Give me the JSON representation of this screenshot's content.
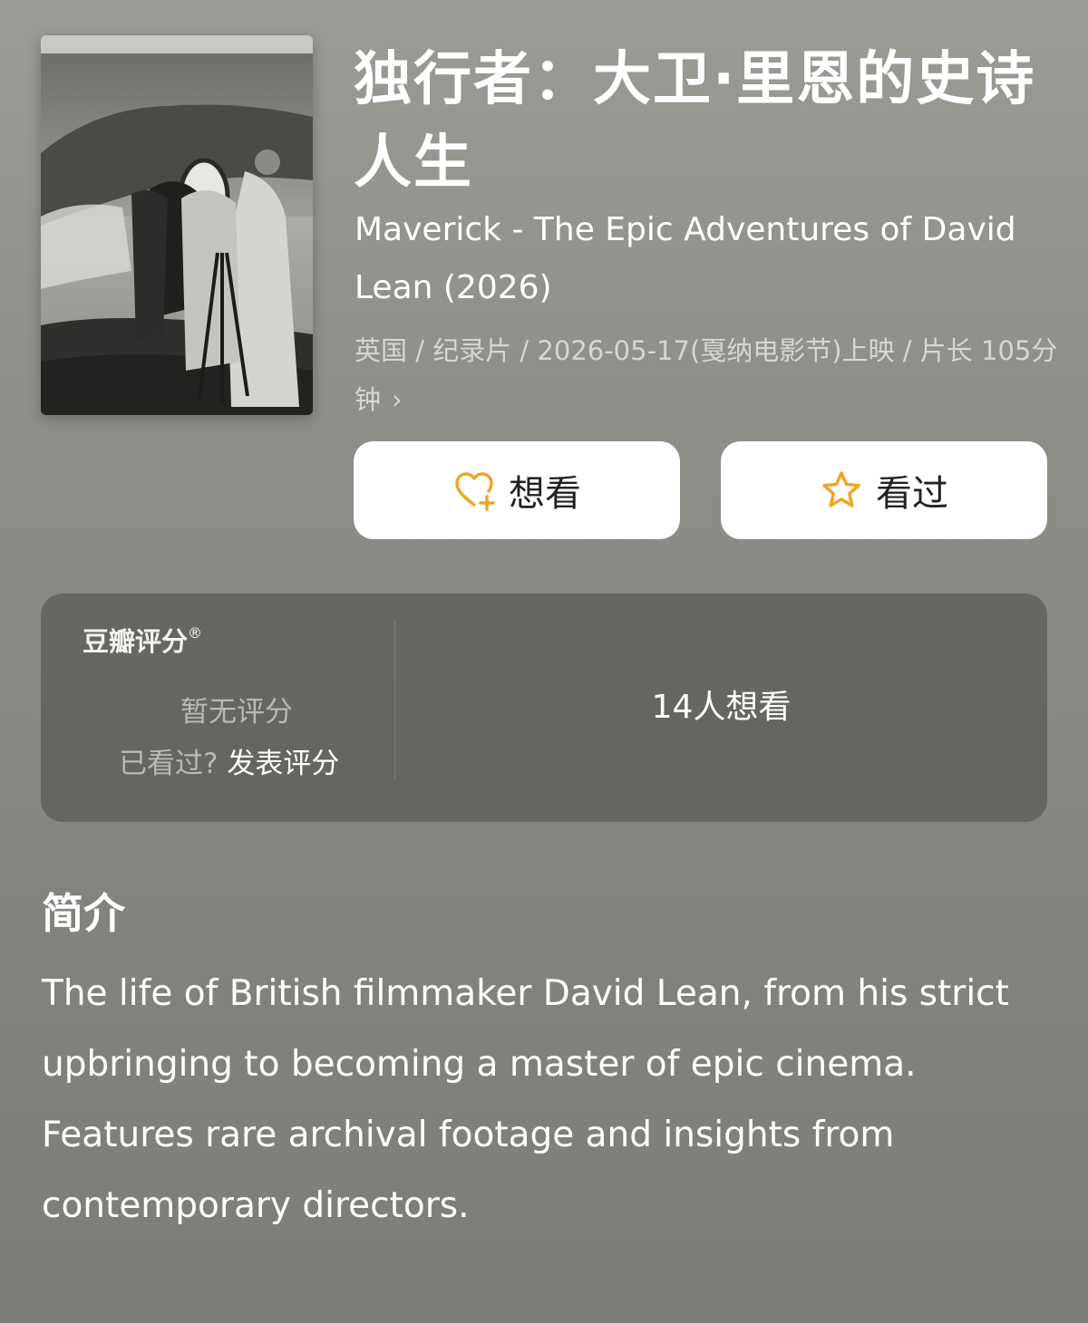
{
  "movie": {
    "title": "独行者：大卫·里恩的史诗人生",
    "original_title": "Maverick - The Epic Adventures of David Lean (2026)",
    "meta": "英国 / 纪录片 / 2026-05-17(戛纳电影节)上映 / 片长 105分钟",
    "meta_chevron": "›"
  },
  "actions": {
    "wish_label": "想看",
    "seen_label": "看过",
    "accent_color": "#f0a623"
  },
  "rating": {
    "brand": "豆瓣评分",
    "brand_mark": "®",
    "no_rating": "暂无评分",
    "watched_prompt": "已看过?",
    "rate_action": "发表评分",
    "wish_count": "14人想看"
  },
  "intro": {
    "heading": "简介",
    "text": "The life of British filmmaker David Lean, from his strict upbringing to becoming a master of epic cinema. Features rare archival footage and insights from contemporary directors."
  }
}
